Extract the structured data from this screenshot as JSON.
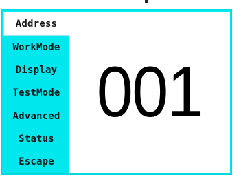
{
  "menu": {
    "items": [
      {
        "label": "Address",
        "active": true
      },
      {
        "label": "WorkMode",
        "active": false
      },
      {
        "label": "Display",
        "active": false
      },
      {
        "label": "TestMode",
        "active": false
      },
      {
        "label": "Advanced",
        "active": false
      },
      {
        "label": "Status",
        "active": false
      },
      {
        "label": "Escape",
        "active": false
      }
    ]
  },
  "display": {
    "value": "001"
  },
  "colors": {
    "menu_background": "#00e8ee",
    "active_item_background": "#ffffff",
    "text": "#1a1a1a"
  }
}
